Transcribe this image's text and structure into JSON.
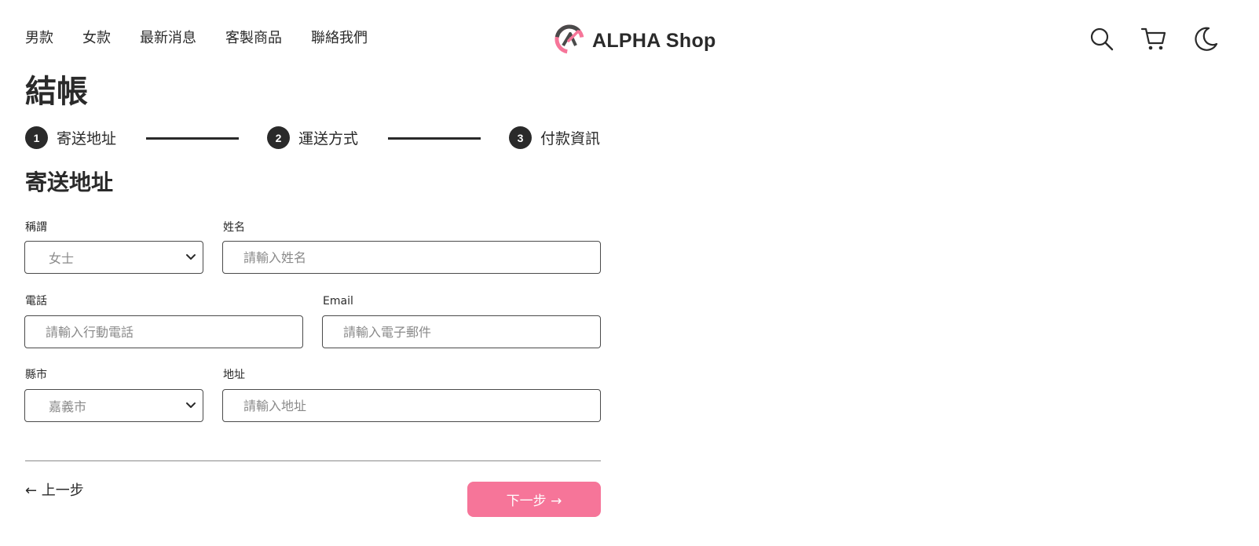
{
  "nav": {
    "items": [
      "男款",
      "女款",
      "最新消息",
      "客製商品",
      "聯絡我們"
    ]
  },
  "brand": {
    "name": "ALPHA Shop",
    "accent_color": "#f67599"
  },
  "header_icons": [
    "search-icon",
    "cart-icon",
    "moon-icon"
  ],
  "page": {
    "title": "結帳"
  },
  "stepper": {
    "steps": [
      {
        "num": "1",
        "label": "寄送地址"
      },
      {
        "num": "2",
        "label": "運送方式"
      },
      {
        "num": "3",
        "label": "付款資訊"
      }
    ]
  },
  "form": {
    "section_title": "寄送地址",
    "salutation": {
      "label": "稱謂",
      "value": "女士"
    },
    "name": {
      "label": "姓名",
      "placeholder": "請輸入姓名"
    },
    "phone": {
      "label": "電話",
      "placeholder": "請輸入行動電話"
    },
    "email": {
      "label": "Email",
      "placeholder": "請輸入電子郵件"
    },
    "city": {
      "label": "縣市",
      "value": "嘉義市"
    },
    "address": {
      "label": "地址",
      "placeholder": "請輸入地址"
    }
  },
  "buttons": {
    "prev": "← 上一步",
    "next": "下一步 →"
  }
}
